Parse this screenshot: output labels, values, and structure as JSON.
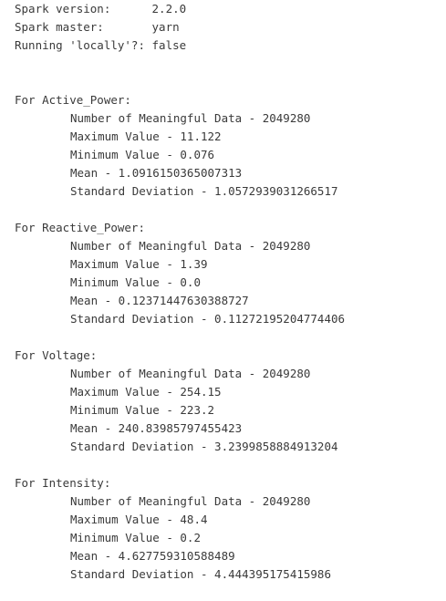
{
  "header": {
    "spark_version": "Spark version:      2.2.0",
    "spark_master": "Spark master:       yarn",
    "running_locally": "Running 'locally'?: false"
  },
  "sections": [
    {
      "heading": "For Active_Power:",
      "stats": [
        "Number of Meaningful Data - 2049280",
        "Maximum Value - 11.122",
        "Minimum Value - 0.076",
        "Mean - 1.0916150365007313",
        "Standard Deviation - 1.0572939031266517"
      ]
    },
    {
      "heading": "For Reactive_Power:",
      "stats": [
        "Number of Meaningful Data - 2049280",
        "Maximum Value - 1.39",
        "Minimum Value - 0.0",
        "Mean - 0.12371447630388727",
        "Standard Deviation - 0.11272195204774406"
      ]
    },
    {
      "heading": "For Voltage:",
      "stats": [
        "Number of Meaningful Data - 2049280",
        "Maximum Value - 254.15",
        "Minimum Value - 223.2",
        "Mean - 240.83985797455423",
        "Standard Deviation - 3.2399858884913204"
      ]
    },
    {
      "heading": "For Intensity:",
      "stats": [
        "Number of Meaningful Data - 2049280",
        "Maximum Value - 48.4",
        "Minimum Value - 0.2",
        "Mean - 4.627759310588489",
        "Standard Deviation - 4.444395175415986"
      ]
    }
  ]
}
